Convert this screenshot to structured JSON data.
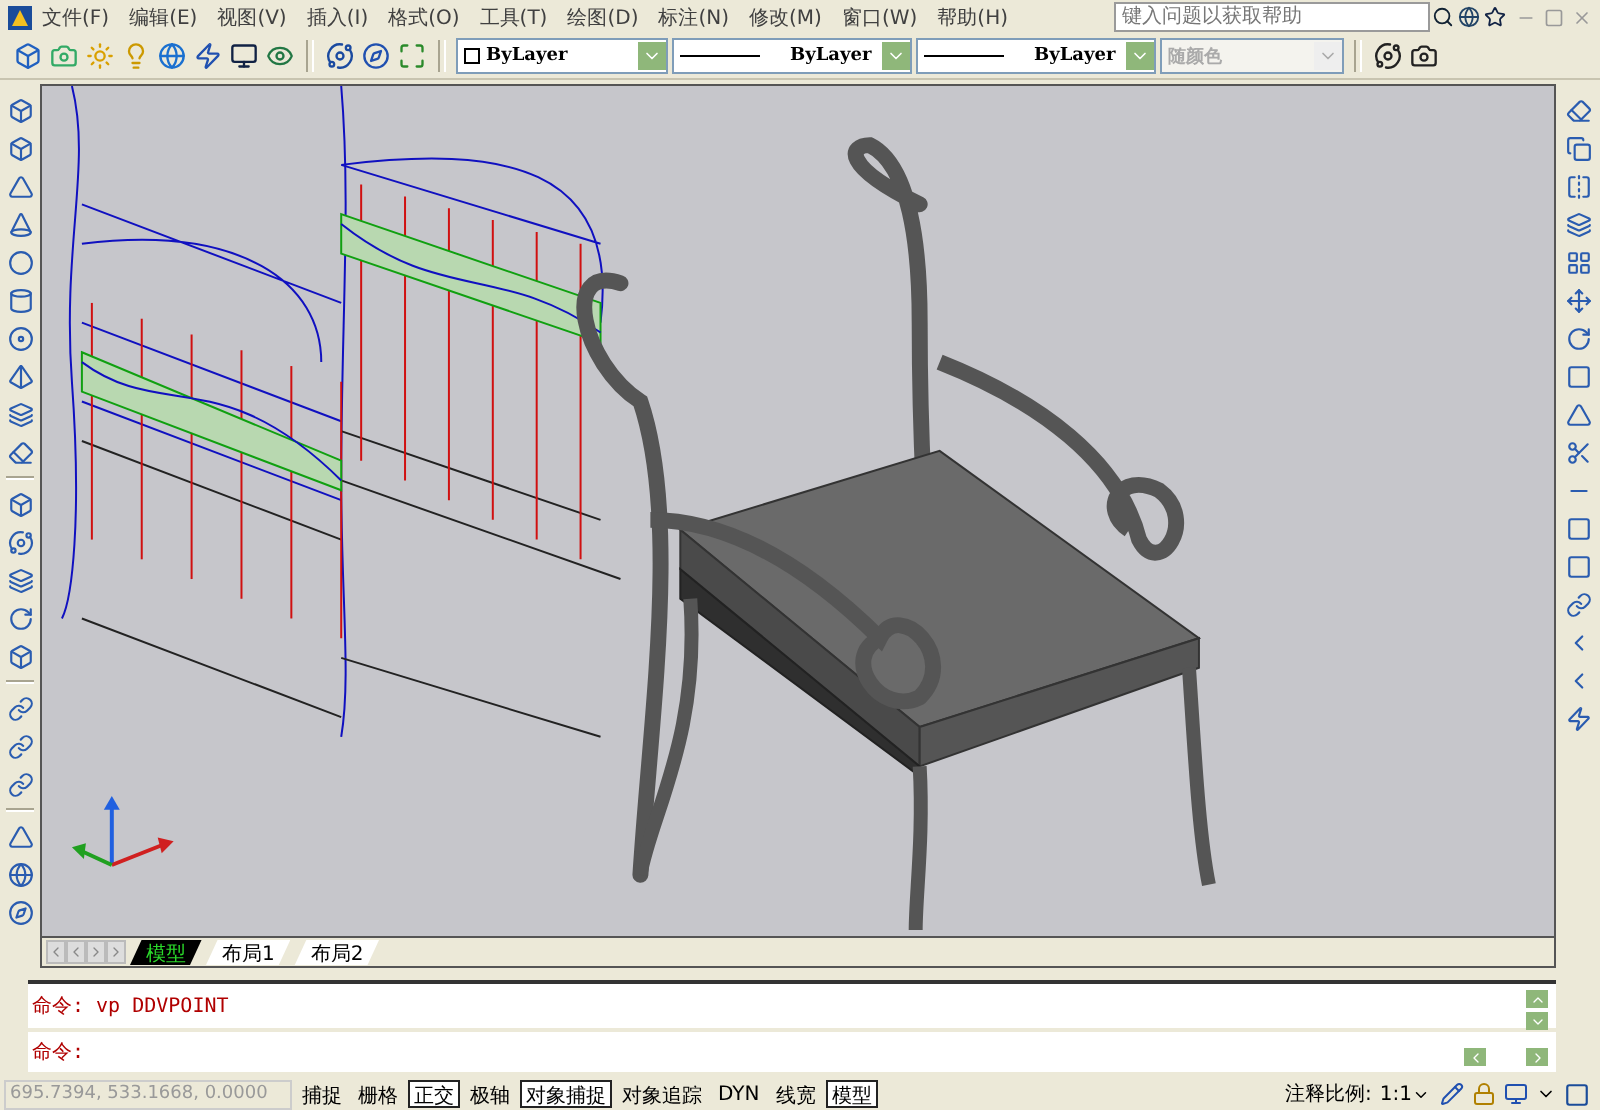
{
  "menus": [
    {
      "label": "文件(F)"
    },
    {
      "label": "编辑(E)"
    },
    {
      "label": "视图(V)"
    },
    {
      "label": "插入(I)"
    },
    {
      "label": "格式(O)"
    },
    {
      "label": "工具(T)"
    },
    {
      "label": "绘图(D)"
    },
    {
      "label": "标注(N)"
    },
    {
      "label": "修改(M)"
    },
    {
      "label": "窗口(W)"
    },
    {
      "label": "帮助(H)"
    }
  ],
  "help_search": {
    "placeholder": "键入问题以获取帮助"
  },
  "properties": [
    {
      "kind": "color",
      "value": "ByLayer",
      "disabled": false
    },
    {
      "kind": "line",
      "value": "ByLayer",
      "disabled": false
    },
    {
      "kind": "line",
      "value": "ByLayer",
      "disabled": false
    },
    {
      "kind": "plain",
      "value": "随颜色",
      "disabled": true
    }
  ],
  "layout_tabs": [
    {
      "label": "模型",
      "selected": true
    },
    {
      "label": "布局1",
      "selected": false
    },
    {
      "label": "布局2",
      "selected": false
    }
  ],
  "command": {
    "history": [
      "命令: vp DDVPOINT"
    ],
    "prompt": "命令:"
  },
  "status_bar": {
    "coordinates": "695.7394, 533.1668, 0.0000",
    "toggles": [
      {
        "label": "捕捉",
        "on": false
      },
      {
        "label": "栅格",
        "on": false
      },
      {
        "label": "正交",
        "on": true
      },
      {
        "label": "极轴",
        "on": false
      },
      {
        "label": "对象捕捉",
        "on": true
      },
      {
        "label": "对象追踪",
        "on": false
      },
      {
        "label": "DYN",
        "on": false
      },
      {
        "label": "线宽",
        "on": false
      },
      {
        "label": "模型",
        "on": true
      }
    ],
    "scale_label": "注释比例:",
    "scale_value": "1:1"
  }
}
